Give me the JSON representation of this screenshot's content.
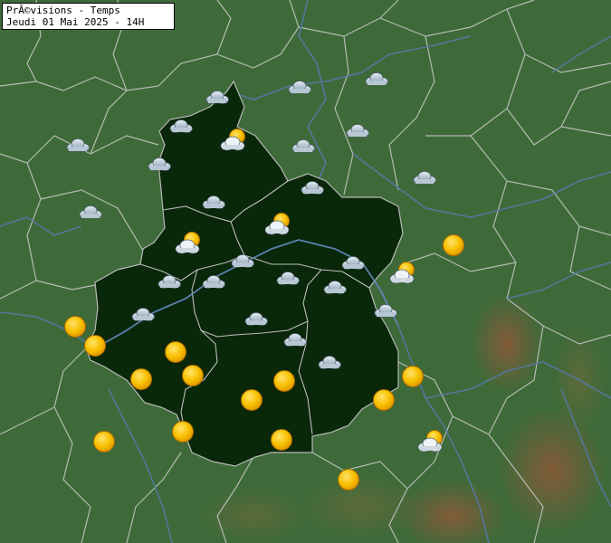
{
  "map": {
    "title": "PrÃ©visions - Temps",
    "subtitle": "Jeudi 01 Mai 2025 - 14H",
    "colors": {
      "background": "#3f6a3a",
      "region": "#0a2a0a",
      "department_border": "#c8c8c8",
      "river": "#4f6f9a",
      "sun": "#f5b400",
      "cloud": "#9fb3c4"
    }
  },
  "markers": [
    {
      "name": "cloud",
      "weather": "cloudy"
    },
    {
      "name": "cloud",
      "weather": "cloudy"
    },
    {
      "name": "cloud",
      "weather": "cloudy"
    },
    {
      "name": "cloud",
      "weather": "cloudy"
    },
    {
      "name": "cloud",
      "weather": "cloudy"
    },
    {
      "name": "cloud",
      "weather": "cloudy"
    },
    {
      "name": "cloud",
      "weather": "cloudy"
    },
    {
      "name": "cloud",
      "weather": "cloudy"
    },
    {
      "name": "cloud",
      "weather": "cloudy"
    },
    {
      "name": "cloud",
      "weather": "cloudy"
    },
    {
      "name": "cloud",
      "weather": "cloudy"
    },
    {
      "name": "cloud",
      "weather": "cloudy"
    },
    {
      "name": "cloud",
      "weather": "cloudy"
    },
    {
      "name": "cloud",
      "weather": "cloudy"
    },
    {
      "name": "cloud",
      "weather": "cloudy"
    },
    {
      "name": "cloud",
      "weather": "cloudy"
    },
    {
      "name": "cloud",
      "weather": "cloudy"
    },
    {
      "name": "cloud",
      "weather": "cloudy"
    },
    {
      "name": "cloud",
      "weather": "cloudy"
    },
    {
      "name": "cloud",
      "weather": "cloudy"
    },
    {
      "name": "cloud",
      "weather": "cloudy"
    },
    {
      "name": "cloud",
      "weather": "cloudy"
    },
    {
      "name": "cloud",
      "weather": "cloudy"
    },
    {
      "name": "partly-cloudy",
      "weather": "partly-cloudy"
    },
    {
      "name": "partly-cloudy",
      "weather": "partly-cloudy"
    },
    {
      "name": "partly-cloudy",
      "weather": "partly-cloudy"
    },
    {
      "name": "partly-cloudy",
      "weather": "partly-cloudy"
    },
    {
      "name": "partly-cloudy",
      "weather": "partly-cloudy"
    },
    {
      "name": "sun",
      "weather": "sunny"
    },
    {
      "name": "sun",
      "weather": "sunny"
    },
    {
      "name": "sun",
      "weather": "sunny"
    },
    {
      "name": "sun",
      "weather": "sunny"
    },
    {
      "name": "sun",
      "weather": "sunny"
    },
    {
      "name": "sun",
      "weather": "sunny"
    },
    {
      "name": "sun",
      "weather": "sunny"
    },
    {
      "name": "sun",
      "weather": "sunny"
    },
    {
      "name": "sun",
      "weather": "sunny"
    },
    {
      "name": "sun",
      "weather": "sunny"
    },
    {
      "name": "sun",
      "weather": "sunny"
    },
    {
      "name": "sun",
      "weather": "sunny"
    },
    {
      "name": "sun",
      "weather": "sunny"
    },
    {
      "name": "sun",
      "weather": "sunny"
    }
  ]
}
